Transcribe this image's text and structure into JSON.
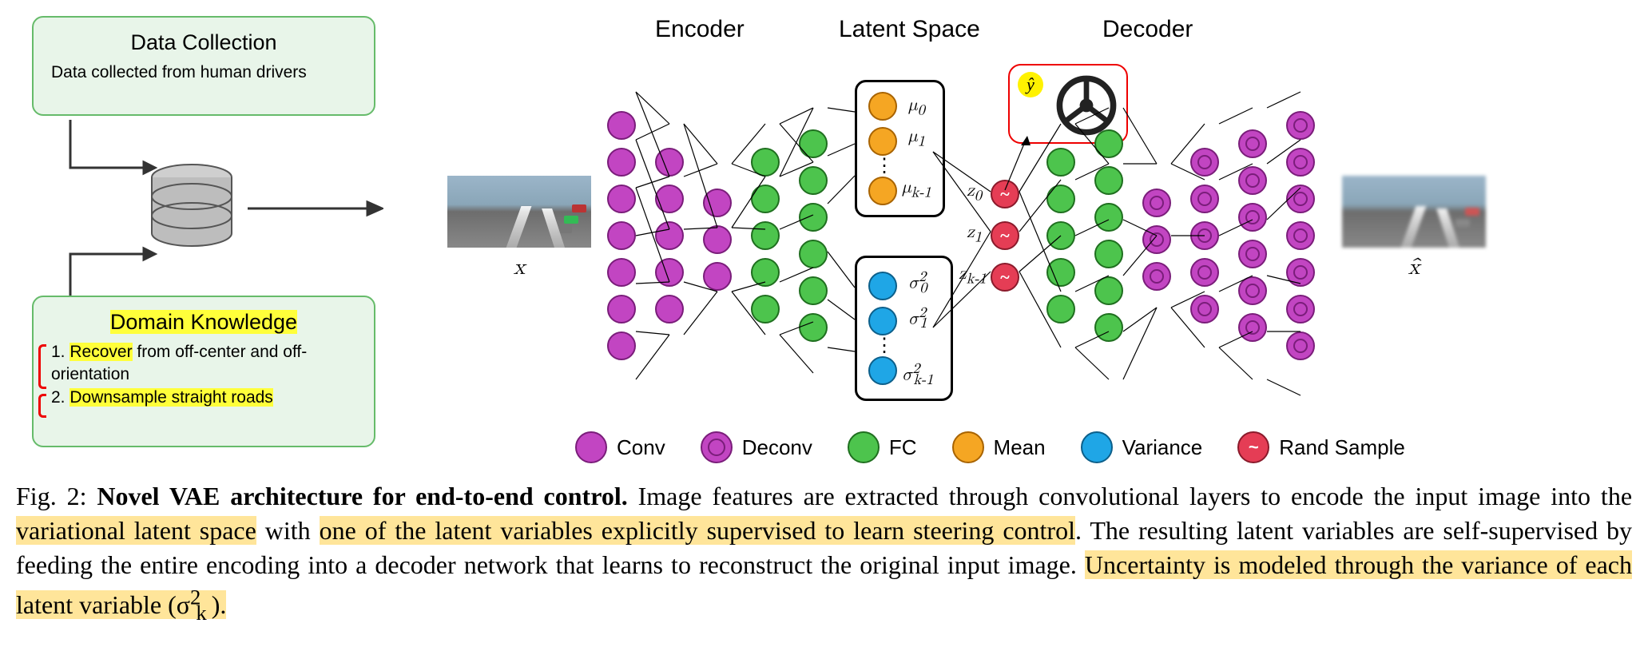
{
  "data_collection": {
    "title": "Data Collection",
    "body": "Data collected from human drivers"
  },
  "domain_knowledge": {
    "title": "Domain Knowledge",
    "item1_prefix": "1. ",
    "item1_hl": "Recover",
    "item1_rest": " from off-center and off-orientation",
    "item2_prefix": "2. ",
    "item2_hl": "Downsample straight roads"
  },
  "sections": {
    "encoder": "Encoder",
    "latent": "Latent Space",
    "decoder": "Decoder"
  },
  "latent_labels": {
    "mu0": "μ",
    "mu0_sub": "0",
    "mu1": "μ",
    "mu1_sub": "1",
    "muk": "μ",
    "muk_sub": "k-1",
    "s0": "σ",
    "s0_sup": "2",
    "s0_sub": "0",
    "s1": "σ",
    "s1_sup": "2",
    "s1_sub": "1",
    "sk": "σ",
    "sk_sup": "2",
    "sk_sub": "k-1",
    "z0": "z",
    "z0_sub": "0",
    "z1": "z",
    "z1_sub": "1",
    "zk": "z",
    "zk_sub": "k-1",
    "yhat": "ŷ"
  },
  "legend": {
    "conv": "Conv",
    "deconv": "Deconv",
    "fc": "FC",
    "mean": "Mean",
    "variance": "Variance",
    "rand": "Rand Sample"
  },
  "caption": {
    "fig": "Fig. 2: ",
    "bold": "Novel VAE architecture for end-to-end control.",
    "t1": " Image features are extracted through convolutional layers to encode the input image into the ",
    "h1": "variational latent space",
    "t2": " with ",
    "h2": "one of the latent variables explicitly supervised to learn steering control",
    "t3": ". The resulting latent variables are self-supervised by feeding the entire encoding into a decoder network that learns to reconstruct the original input image. ",
    "h3": "Uncertainty is modeled through the variance of each latent variable (σ",
    "h3_sup": "2",
    "h3_sub": "k",
    "h3_end": ").",
    "tail": ""
  },
  "thumbs": {
    "x": "x",
    "xhat": "x̂"
  }
}
